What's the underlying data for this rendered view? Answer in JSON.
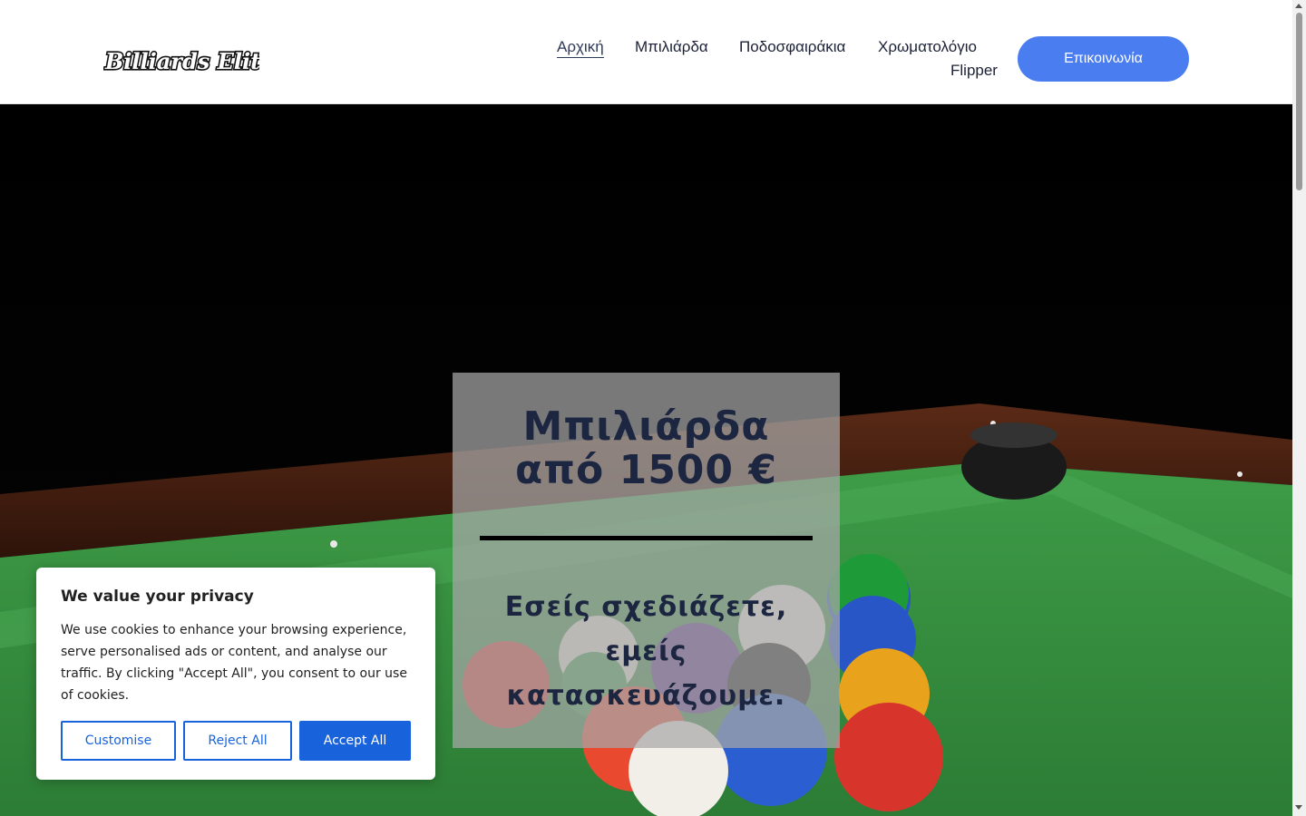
{
  "header": {
    "logo_text": "Billiards Elite",
    "nav": [
      {
        "label": "Αρχική",
        "active": true
      },
      {
        "label": "Μπιλιάρδα"
      },
      {
        "label": "Ποδοσφαιράκια"
      },
      {
        "label": "Χρωματολόγιο"
      },
      {
        "label": "Flipper"
      }
    ],
    "cta_label": "Επικοινωνία"
  },
  "hero": {
    "title_line1": "Μπιλιάρδα",
    "title_line2": "από 1500 €",
    "subtitle_line1": "Εσείς σχεδιάζετε,",
    "subtitle_line2": "εμείς",
    "subtitle_line3": "κατασκευάζουμε."
  },
  "cookie_banner": {
    "title": "We value your privacy",
    "body": "We use cookies to enhance your browsing experience, serve personalised ads or content, and analyse our traffic. By clicking \"Accept All\", you consent to our use of cookies.",
    "customise_label": "Customise",
    "reject_label": "Reject All",
    "accept_label": "Accept All"
  },
  "colors": {
    "accent": "#4a7df0",
    "cookie_button": "#1863dc",
    "text_dark": "#1c2640",
    "felt_green": "#2f8a3a"
  }
}
